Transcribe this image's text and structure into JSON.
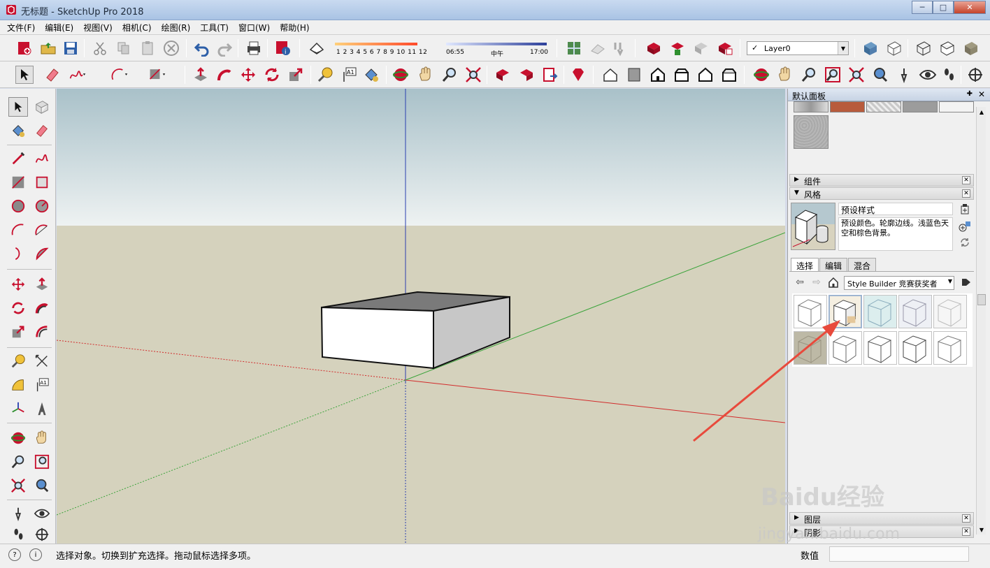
{
  "window": {
    "title": "无标题 - SketchUp Pro 2018",
    "minimize": "─",
    "maximize": "□",
    "close": "✕"
  },
  "menu": [
    "文件(F)",
    "编辑(E)",
    "视图(V)",
    "相机(C)",
    "绘图(R)",
    "工具(T)",
    "窗口(W)",
    "帮助(H)"
  ],
  "toolbar": {
    "shadow_months": "1  2  3  4  5  6  7  8  9  10 11 12",
    "time_start": "06:55",
    "time_mid": "中午",
    "time_end": "17:00",
    "layer_check": "✓",
    "layer_name": "Layer0",
    "dropdown_arrow": "▼"
  },
  "tray": {
    "title": "默认面板",
    "pin": "✚",
    "close": "✕",
    "sections": {
      "components": "组件",
      "styles": "风格",
      "layers": "图层",
      "shadows": "阴影"
    },
    "collapsed_tri": "▶",
    "expanded_tri": "▼",
    "style_name": "预设样式",
    "style_desc": "预设颜色。轮廓边线。浅蓝色天空和棕色背景。",
    "tabs": [
      "选择",
      "编辑",
      "混合"
    ],
    "collection": "Style Builder 竞赛获奖者"
  },
  "status": {
    "text": "选择对象。切换到扩充选择。拖动鼠标选择多项。",
    "value_label": "数值",
    "value": "",
    "help_icon": "?",
    "info_icon": "i"
  },
  "watermark": {
    "line1": "Baidu经验",
    "line2": "jingyan.baidu.com"
  },
  "colors": {
    "sky_top": "#a9c1c9",
    "ground": "#d5d2bd",
    "axis_red": "#d22b2b",
    "axis_green": "#3aa33a",
    "axis_blue": "#2a3fb0",
    "arrow": "#e84a3c"
  }
}
